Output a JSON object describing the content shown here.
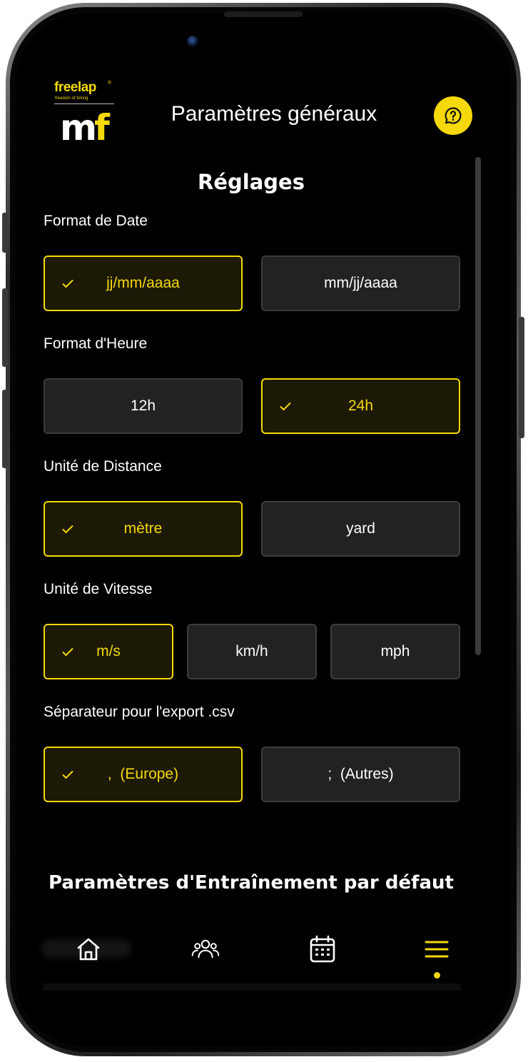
{
  "app": {
    "logo_word": "freelap",
    "logo_tagline": "freedom of timing",
    "logo_mark_m": "m",
    "logo_mark_f": "f"
  },
  "header": {
    "title": "Paramètres généraux",
    "help_icon": "chat-question-icon"
  },
  "settings": {
    "section_title": "Réglages",
    "date_format": {
      "label": "Format de Date",
      "options": [
        {
          "label": "jj/mm/aaaa",
          "selected": true
        },
        {
          "label": "mm/jj/aaaa",
          "selected": false
        }
      ]
    },
    "time_format": {
      "label": "Format d'Heure",
      "options": [
        {
          "label": "12h",
          "selected": false
        },
        {
          "label": "24h",
          "selected": true
        }
      ]
    },
    "distance_unit": {
      "label": "Unité de Distance",
      "options": [
        {
          "label": "mètre",
          "selected": true
        },
        {
          "label": "yard",
          "selected": false
        }
      ]
    },
    "speed_unit": {
      "label": "Unité de Vitesse",
      "options": [
        {
          "label": "m/s",
          "selected": true
        },
        {
          "label": "km/h",
          "selected": false
        },
        {
          "label": "mph",
          "selected": false
        }
      ]
    },
    "csv_separator": {
      "label": "Séparateur pour l'export .csv",
      "options": [
        {
          "label": ",  (Europe)",
          "selected": true
        },
        {
          "label": ";  (Autres)",
          "selected": false
        }
      ]
    }
  },
  "training": {
    "section_title": "Paramètres d'Entraînement par défaut"
  },
  "tabbar": {
    "items": [
      {
        "icon": "home-icon",
        "active": false
      },
      {
        "icon": "users-icon",
        "active": false
      },
      {
        "icon": "calendar-icon",
        "active": false
      },
      {
        "icon": "menu-icon",
        "active": true
      }
    ]
  },
  "colors": {
    "accent": "#f5d90a",
    "background": "#000000",
    "option_bg": "#222222",
    "option_border": "#3c3c3c"
  }
}
